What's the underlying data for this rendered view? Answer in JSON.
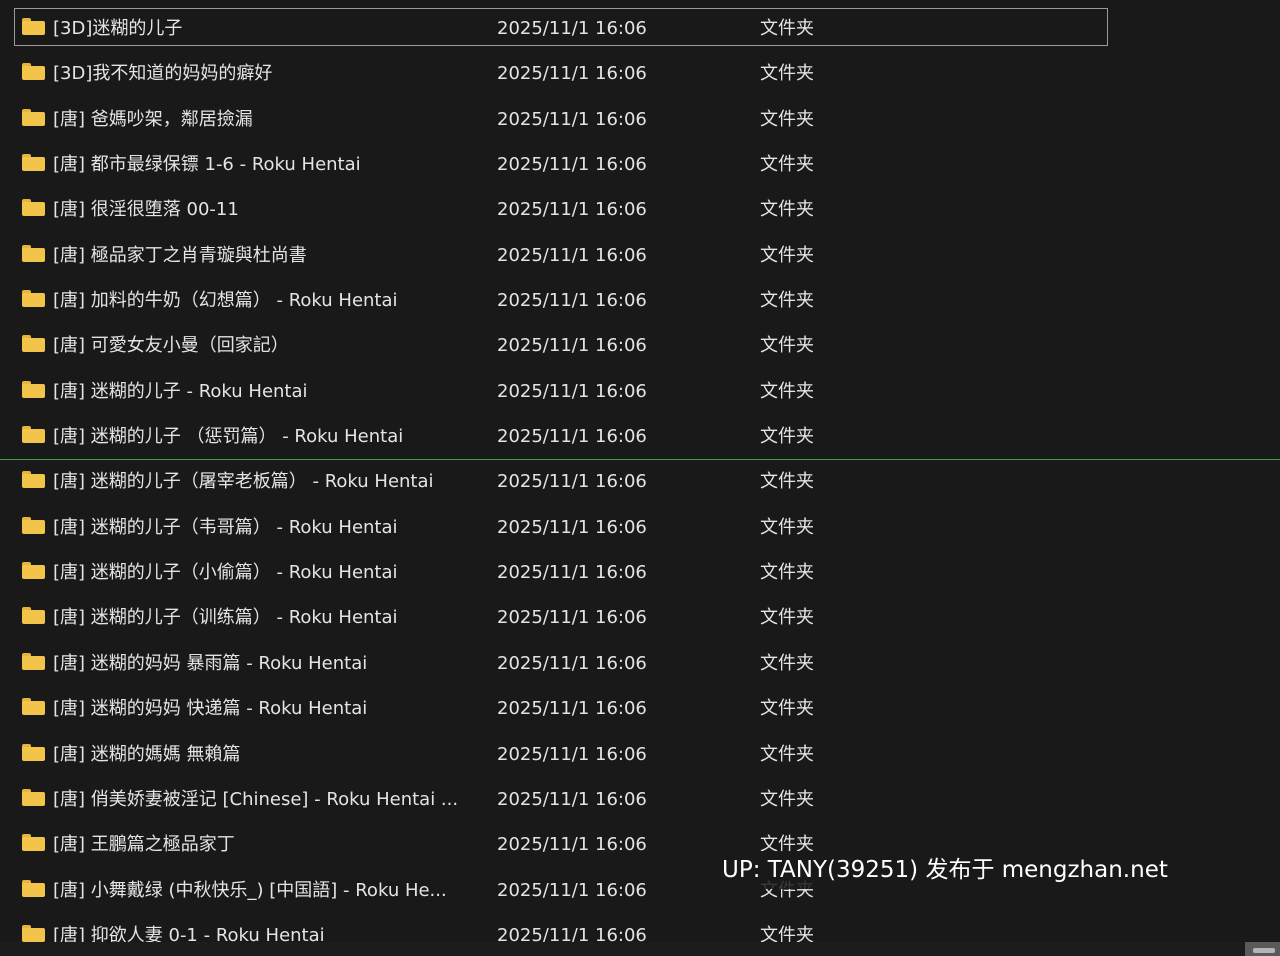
{
  "file_list": {
    "items": [
      {
        "name": "[3D]迷糊的儿子",
        "modified": "2025/11/1 16:06",
        "type": "文件夹"
      },
      {
        "name": "[3D]我不知道的妈妈的癖好",
        "modified": "2025/11/1 16:06",
        "type": "文件夹"
      },
      {
        "name": "[唐] 爸媽吵架，鄰居撿漏",
        "modified": "2025/11/1 16:06",
        "type": "文件夹"
      },
      {
        "name": "[唐] 都市最绿保镖 1-6 - Roku Hentai",
        "modified": "2025/11/1 16:06",
        "type": "文件夹"
      },
      {
        "name": "[唐] 很淫很堕落 00-11",
        "modified": "2025/11/1 16:06",
        "type": "文件夹"
      },
      {
        "name": "[唐] 極品家丁之肖青璇與杜尚書",
        "modified": "2025/11/1 16:06",
        "type": "文件夹"
      },
      {
        "name": "[唐] 加料的牛奶（幻想篇） - Roku Hentai",
        "modified": "2025/11/1 16:06",
        "type": "文件夹"
      },
      {
        "name": "[唐] 可愛女友小曼（回家記）",
        "modified": "2025/11/1 16:06",
        "type": "文件夹"
      },
      {
        "name": "[唐] 迷糊的儿子 - Roku Hentai",
        "modified": "2025/11/1 16:06",
        "type": "文件夹"
      },
      {
        "name": "[唐] 迷糊的儿子 （惩罚篇） - Roku Hentai",
        "modified": "2025/11/1 16:06",
        "type": "文件夹"
      },
      {
        "name": "[唐] 迷糊的儿子（屠宰老板篇） - Roku Hentai",
        "modified": "2025/11/1 16:06",
        "type": "文件夹"
      },
      {
        "name": "[唐] 迷糊的儿子（韦哥篇） - Roku Hentai",
        "modified": "2025/11/1 16:06",
        "type": "文件夹"
      },
      {
        "name": "[唐] 迷糊的儿子（小偷篇） - Roku Hentai",
        "modified": "2025/11/1 16:06",
        "type": "文件夹"
      },
      {
        "name": "[唐] 迷糊的儿子（训练篇） - Roku Hentai",
        "modified": "2025/11/1 16:06",
        "type": "文件夹"
      },
      {
        "name": "[唐] 迷糊的妈妈 暴雨篇 - Roku Hentai",
        "modified": "2025/11/1 16:06",
        "type": "文件夹"
      },
      {
        "name": "[唐] 迷糊的妈妈 快递篇 - Roku Hentai",
        "modified": "2025/11/1 16:06",
        "type": "文件夹"
      },
      {
        "name": "[唐] 迷糊的媽媽 無賴篇",
        "modified": "2025/11/1 16:06",
        "type": "文件夹"
      },
      {
        "name": "[唐] 俏美娇妻被淫记 [Chinese] - Roku Hentai ...",
        "modified": "2025/11/1 16:06",
        "type": "文件夹"
      },
      {
        "name": "[唐] 王鵬篇之極品家丁",
        "modified": "2025/11/1 16:06",
        "type": "文件夹"
      },
      {
        "name": "[唐] 小舞戴绿 (中秋快乐_) [中国語] - Roku He...",
        "modified": "2025/11/1 16:06",
        "type": "文件夹"
      },
      {
        "name": "[唐] 抑欲人妻 0-1 - Roku Hentai",
        "modified": "2025/11/1 16:06",
        "type": "文件夹"
      }
    ],
    "selected_index": 0
  },
  "watermark": {
    "text": "UP: TANY(39251) 发布于 mengzhan.net"
  },
  "colors": {
    "background": "#191919",
    "text": "#e4e4e4",
    "folder": "#f2c44a",
    "selection_border": "#9a9a9a",
    "drop_indicator": "#3f9e3f"
  }
}
